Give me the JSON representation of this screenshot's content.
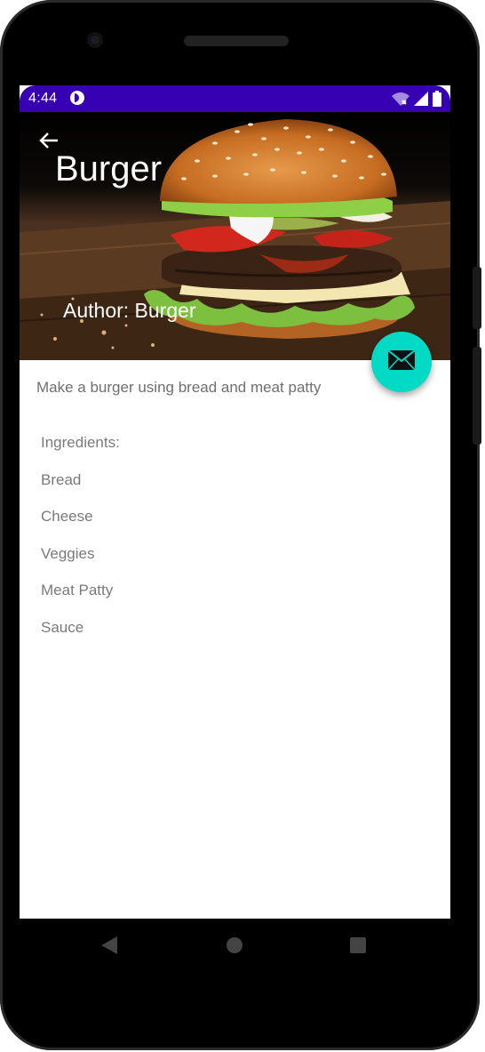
{
  "status_bar": {
    "time": "4:44",
    "app_icon": "app-notification-icon",
    "icons": [
      "wifi-icon",
      "signal-icon",
      "battery-icon"
    ]
  },
  "header": {
    "title": "Burger",
    "author": "Author: Burger",
    "image": "burger-photo",
    "back_icon": "back-arrow-icon"
  },
  "fab": {
    "icon": "mail-icon",
    "color": "#03dac5"
  },
  "content": {
    "description": "Make a burger using bread and meat patty",
    "ingredients_heading": "Ingredients:",
    "ingredients": [
      "Bread",
      "Cheese",
      "Veggies",
      "Meat Patty",
      "Sauce"
    ]
  },
  "nav_bar": {
    "icons": [
      "nav-back-icon",
      "nav-home-icon",
      "nav-recents-icon"
    ]
  },
  "colors": {
    "status_bar": "#3700b3",
    "fab": "#03dac5",
    "text_secondary": "#7a7a7a"
  }
}
